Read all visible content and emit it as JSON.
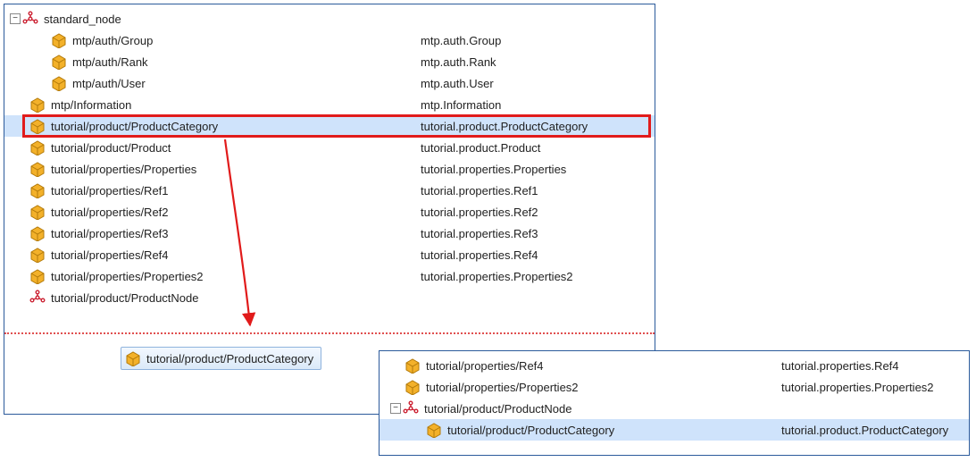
{
  "icons": {
    "expand_minus": "−",
    "expand_plus": "+"
  },
  "main": {
    "root": {
      "label": "standard_node"
    },
    "items": [
      {
        "label": "mtp/auth/Group",
        "value": "mtp.auth.Group",
        "indent": 2,
        "icon": "package"
      },
      {
        "label": "mtp/auth/Rank",
        "value": "mtp.auth.Rank",
        "indent": 2,
        "icon": "package"
      },
      {
        "label": "mtp/auth/User",
        "value": "mtp.auth.User",
        "indent": 2,
        "icon": "package"
      },
      {
        "label": "mtp/Information",
        "value": "mtp.Information",
        "indent": 1,
        "icon": "package"
      },
      {
        "label": "tutorial/product/ProductCategory",
        "value": "tutorial.product.ProductCategory",
        "indent": 1,
        "icon": "package",
        "selected": true,
        "highlight": true
      },
      {
        "label": "tutorial/product/Product",
        "value": "tutorial.product.Product",
        "indent": 1,
        "icon": "package"
      },
      {
        "label": "tutorial/properties/Properties",
        "value": "tutorial.properties.Properties",
        "indent": 1,
        "icon": "package"
      },
      {
        "label": "tutorial/properties/Ref1",
        "value": "tutorial.properties.Ref1",
        "indent": 1,
        "icon": "package"
      },
      {
        "label": "tutorial/properties/Ref2",
        "value": "tutorial.properties.Ref2",
        "indent": 1,
        "icon": "package"
      },
      {
        "label": "tutorial/properties/Ref3",
        "value": "tutorial.properties.Ref3",
        "indent": 1,
        "icon": "package"
      },
      {
        "label": "tutorial/properties/Ref4",
        "value": "tutorial.properties.Ref4",
        "indent": 1,
        "icon": "package"
      },
      {
        "label": "tutorial/properties/Properties2",
        "value": "tutorial.properties.Properties2",
        "indent": 1,
        "icon": "package"
      },
      {
        "label": "tutorial/product/ProductNode",
        "value": "",
        "indent": 1,
        "icon": "node"
      }
    ],
    "drag_ghost": {
      "label": "tutorial/product/ProductCategory"
    }
  },
  "secondary": {
    "items": [
      {
        "label": "tutorial/properties/Ref4",
        "value": "tutorial.properties.Ref4",
        "indent": 1,
        "icon": "package"
      },
      {
        "label": "tutorial/properties/Properties2",
        "value": "tutorial.properties.Properties2",
        "indent": 1,
        "icon": "package"
      },
      {
        "label": "tutorial/product/ProductNode",
        "value": "",
        "indent": 1,
        "icon": "node",
        "expander": "minus"
      },
      {
        "label": "tutorial/product/ProductCategory",
        "value": "tutorial.product.ProductCategory",
        "indent": 2,
        "icon": "package",
        "selected": true
      }
    ]
  }
}
